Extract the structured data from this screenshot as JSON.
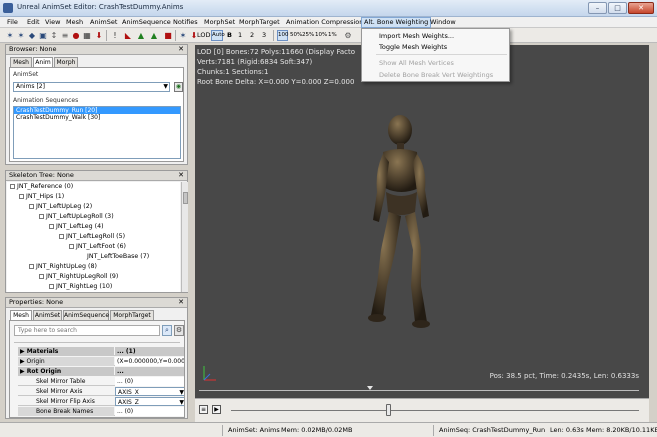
{
  "window": {
    "title": "Unreal AnimSet Editor: CrashTestDummy.Anims",
    "buttons": {
      "minimize": "–",
      "maximize": "□",
      "close": "✕"
    }
  },
  "menubar": {
    "items": [
      {
        "label": "File"
      },
      {
        "label": "Edit"
      },
      {
        "label": "View"
      },
      {
        "label": "Mesh"
      },
      {
        "label": "AnimSet"
      },
      {
        "label": "AnimSequence"
      },
      {
        "label": "Notifies"
      },
      {
        "label": "MorphSet"
      },
      {
        "label": "MorphTarget"
      },
      {
        "label": "Animation Compression"
      },
      {
        "label": "Alt. Bone Weighting"
      },
      {
        "label": "Window"
      }
    ]
  },
  "toolbar": {
    "lod_label": "LOD:",
    "lod_auto": "Auto",
    "lod_bold": "B",
    "lod_levels": [
      "1",
      "2",
      "3"
    ],
    "speeds": [
      "100",
      "50%",
      "25%",
      "10%",
      "1%"
    ]
  },
  "alt_bone_menu": {
    "items": [
      {
        "label": "Import Mesh Weights...",
        "enabled": true
      },
      {
        "label": "Toggle Mesh Weights",
        "enabled": true
      },
      {
        "label": "Show All Mesh Vertices",
        "enabled": false
      },
      {
        "label": "Delete Bone Break Vert Weightings",
        "enabled": false
      }
    ]
  },
  "browser": {
    "header": "Browser: None",
    "tabs": [
      "Mesh",
      "Anim",
      "Morph"
    ],
    "animset_label": "AnimSet",
    "animset_value": "Anims [2]",
    "sequences_label": "Animation Sequences",
    "sequences": [
      {
        "label": "CrashTestDummy_Run [20]",
        "selected": true
      },
      {
        "label": "CrashTestDummy_Walk [30]",
        "selected": false
      }
    ]
  },
  "skeleton": {
    "header": "Skeleton Tree: None",
    "nodes": [
      {
        "label": "JNT_Reference (0)",
        "depth": 0
      },
      {
        "label": "JNT_Hips (1)",
        "depth": 1
      },
      {
        "label": "JNT_LeftUpLeg (2)",
        "depth": 2
      },
      {
        "label": "JNT_LeftUpLegRoll (3)",
        "depth": 3
      },
      {
        "label": "JNT_LeftLeg (4)",
        "depth": 4
      },
      {
        "label": "JNT_LeftLegRoll (5)",
        "depth": 5
      },
      {
        "label": "JNT_LeftFoot (6)",
        "depth": 6
      },
      {
        "label": "JNT_LeftToeBase (7)",
        "depth": 7
      },
      {
        "label": "JNT_RightUpLeg (8)",
        "depth": 2
      },
      {
        "label": "JNT_RightUpLegRoll (9)",
        "depth": 3
      },
      {
        "label": "JNT_RightLeg (10)",
        "depth": 4
      }
    ]
  },
  "properties": {
    "header": "Properties: None",
    "tabs": [
      "Mesh",
      "AnimSet",
      "AnimSequence",
      "MorphTarget"
    ],
    "search_placeholder": "Type here to search",
    "rows": [
      {
        "name": "Materials",
        "value": "... (1)",
        "type": "cat"
      },
      {
        "name": "Origin",
        "value": "(X=0.000000,Y=0.000000",
        "type": "sub"
      },
      {
        "name": "Rot Origin",
        "value": "...",
        "type": "cat"
      },
      {
        "name": "Skel Mirror Table",
        "value": "... (0)",
        "type": "plain"
      },
      {
        "name": "Skel Mirror Axis",
        "value": "AXIS_X",
        "type": "plain"
      },
      {
        "name": "Skel Mirror Flip Axis",
        "value": "AXIS_Z",
        "type": "plain"
      },
      {
        "name": "Bone Break Names",
        "value": "... (0)",
        "type": "plain"
      }
    ]
  },
  "viewport": {
    "lines": [
      "LOD [0] Bones:72 Polys:11660 (Display Facto",
      "Verts:7181 (Rigid:6834 Soft:347)",
      "Chunks:1 Sections:1",
      "Root Bone Delta: X=0.000 Y=0.000 Z=0.000"
    ],
    "status": "Pos: 38.5 pct, Time: 0.2435s, Len: 0.6333s",
    "colors": {
      "background": "#484848",
      "text": "#e6e6e6"
    }
  },
  "timeline": {
    "progress": 0.385
  },
  "statusbar": {
    "animset": "AnimSet: Anims",
    "animset_mem": "Mem: 0.02MB/0.02MB",
    "animseq": "AnimSeq: CrashTestDummy_Run",
    "animseq_len": "Len: 0.63s",
    "animseq_mem": "Mem: 8.20KB/10.11KB"
  }
}
